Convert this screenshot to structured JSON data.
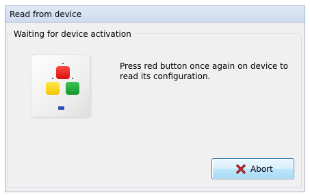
{
  "window": {
    "title": "Read from device"
  },
  "group": {
    "label": "Waiting for device activation"
  },
  "device_image": {
    "icon": "device-remote",
    "button_colors": {
      "red": "#e22a25",
      "yellow": "#f5d11c",
      "green": "#1ea83a"
    }
  },
  "message": {
    "text": "Press red button once again on device to read its configuration."
  },
  "buttons": {
    "abort_label": "Abort",
    "abort_icon": "close-icon"
  }
}
